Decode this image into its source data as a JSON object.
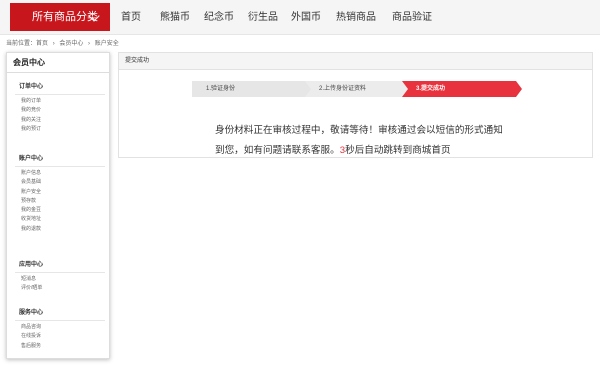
{
  "nav": {
    "category_label": "所有商品分类",
    "items": [
      "首页",
      "熊猫币",
      "纪念币",
      "衍生品",
      "外国币",
      "热销商品",
      "商品验证"
    ]
  },
  "breadcrumb": {
    "items": [
      "当前位置：首页",
      "›",
      "会员中心",
      "›",
      "账户安全"
    ]
  },
  "sidebar": {
    "title": "会员中心",
    "sections": [
      {
        "title": "订单中心",
        "items": [
          "我的订单",
          "我的竞价",
          "我的关注",
          "我的预订"
        ]
      },
      {
        "title": "账户中心",
        "items": [
          "账户信息",
          "会员基础",
          "账户安全",
          "预存款",
          "我的金豆",
          "收货地址",
          "我的退款"
        ]
      },
      {
        "title": "应用中心",
        "items": [
          "短消息",
          "评价/晒单"
        ]
      },
      {
        "title": "服务中心",
        "items": [
          "商品咨询",
          "在线投诉",
          "售后服务"
        ]
      }
    ]
  },
  "panel": {
    "title": "提交成功",
    "steps": [
      "1.验证身份",
      "2.上传身份证资料",
      "3.提交成功"
    ],
    "message_line1": "身份材料正在审核过程中，敬请等待！审核通过会以短信的形式通知",
    "message_line2_pre": "到您，如有问题请联系客服。",
    "countdown": "3",
    "message_line2_post": "秒后自动跳转到商城首页"
  },
  "colors": {
    "brand_red": "#c8161d",
    "step_active": "#e8323d"
  }
}
